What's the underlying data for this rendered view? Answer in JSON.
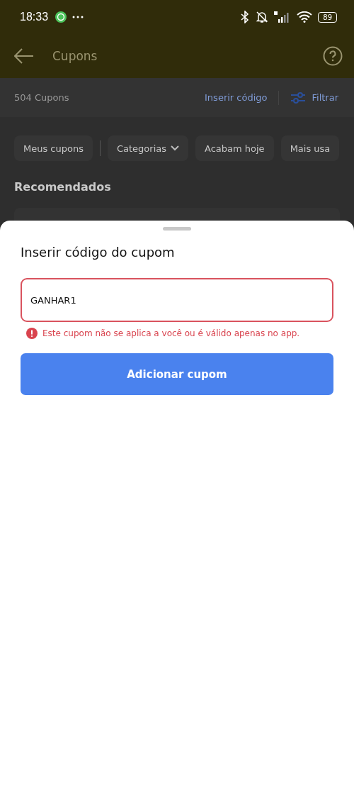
{
  "status_bar": {
    "time": "18:33",
    "battery": "89"
  },
  "header": {
    "title": "Cupons"
  },
  "summary": {
    "count": "504 Cupons",
    "insert_link": "Inserir código",
    "filter": "Filtrar"
  },
  "chips": [
    {
      "label": "Meus cupons",
      "dropdown": false
    },
    {
      "label": "Categorias",
      "dropdown": true
    },
    {
      "label": "Acabam hoje",
      "dropdown": false
    },
    {
      "label": "Mais usa",
      "dropdown": false
    }
  ],
  "section_title": "Recomendados",
  "sheet": {
    "title": "Inserir código do cupom",
    "field": {
      "value": "GANHAR1",
      "invalid": true
    },
    "error": "Este cupom não se aplica a você ou é válido apenas no app.",
    "button": "Adicionar cupom"
  }
}
